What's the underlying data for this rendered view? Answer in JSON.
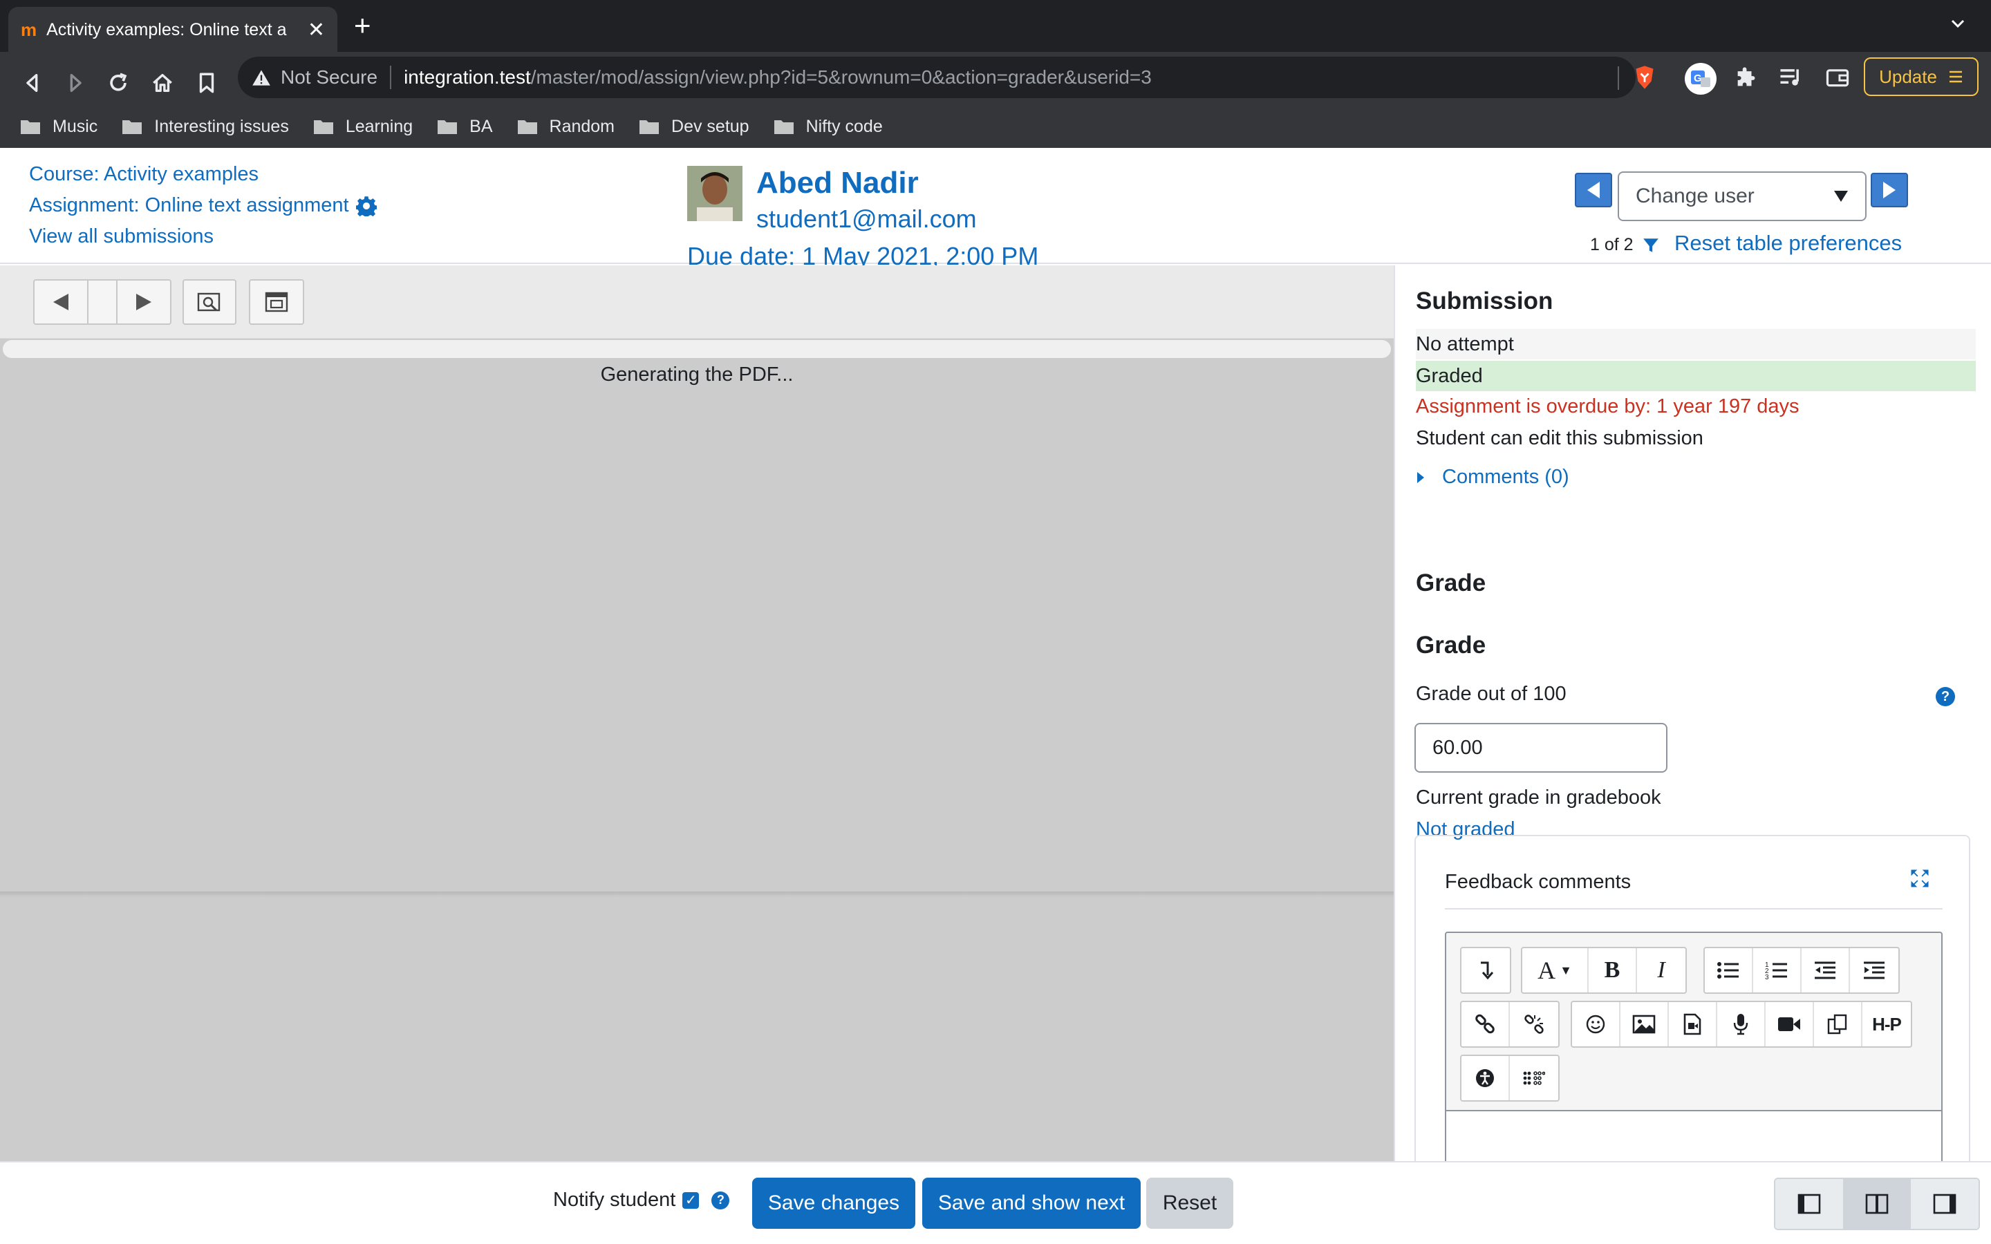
{
  "browser": {
    "tab_title": "Activity examples: Online text a",
    "security_label": "Not Secure",
    "url_host": "integration.test",
    "url_path": "/master/mod/assign/view.php?id=5&rownum=0&action=grader&userid=3",
    "update_label": "Update",
    "bookmarks": [
      "Music",
      "Interesting issues",
      "Learning",
      "BA",
      "Random",
      "Dev setup",
      "Nifty code"
    ]
  },
  "header": {
    "course_link": "Course: Activity examples",
    "assignment_link": "Assignment: Online text assignment",
    "view_all_link": "View all submissions",
    "user_name": "Abed Nadir",
    "user_email": "student1@mail.com",
    "due_date": "Due date: 1 May 2021, 2:00 PM",
    "change_user_placeholder": "Change user",
    "pager": "1 of 2",
    "reset_link": "Reset table preferences"
  },
  "pdf": {
    "status": "Generating the PDF..."
  },
  "submission": {
    "heading": "Submission",
    "attempt_status": "No attempt",
    "grading_status": "Graded",
    "overdue": "Assignment is overdue by: 1 year 197 days",
    "edit_status": "Student can edit this submission",
    "comments": "Comments (0)"
  },
  "grade": {
    "section_heading": "Grade",
    "sub_heading": "Grade",
    "out_of_label": "Grade out of 100",
    "value": "60.00",
    "gradebook_label": "Current grade in gradebook",
    "gradebook_value": "Not graded"
  },
  "feedback": {
    "title": "Feedback comments"
  },
  "footer": {
    "notify_label": "Notify student",
    "save_label": "Save changes",
    "save_next_label": "Save and show next",
    "reset_label": "Reset"
  },
  "colors": {
    "brand": "#0f6cbf",
    "graded_bg": "#d7efd7",
    "overdue": "#ca3120"
  }
}
